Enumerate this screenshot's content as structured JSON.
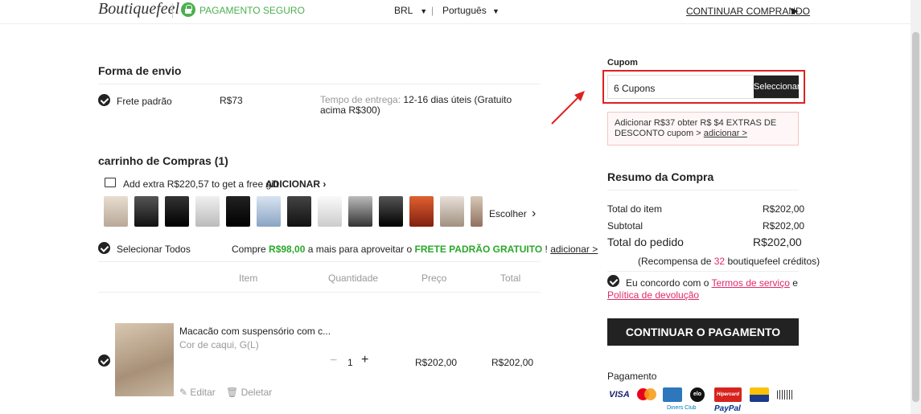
{
  "header": {
    "logo": "Boutiquefeel",
    "secure": "PAGAMENTO SEGURO",
    "currency": "BRL",
    "language": "Português",
    "continue": "CONTINUAR COMPRANDO"
  },
  "shipping": {
    "title": "Forma de envio",
    "method": "Frete padrão",
    "price": "R$73",
    "time_label": "Tempo de entrega:",
    "time_value": "12-16 dias úteis (Gratuito acima R$300)"
  },
  "cart": {
    "title": "carrinho de Compras (1)",
    "gift_text": "Add extra R$220,57 to get a free gift",
    "gift_add": "ADICIONAR",
    "choose": "Escolher",
    "select_all": "Selecionar Todos",
    "free_pre": "Compre",
    "free_amount": "R$98,00",
    "free_mid": "a mais para aproveitar o",
    "free_label": "FRETE PADRÃO GRATUITO",
    "free_post": "!",
    "free_add": "adicionar >",
    "cols": [
      "Item",
      "Quantidade",
      "Preço",
      "Total"
    ],
    "item": {
      "name": "Macacão com suspensório com c...",
      "variant": "Cor de caqui, G(L)",
      "qty": "1",
      "price": "R$202,00",
      "total": "R$202,00",
      "edit": "Editar",
      "delete": "Deletar"
    }
  },
  "coupon": {
    "label": "Cupom",
    "value": "6 Cupons",
    "button": "Seleccionar",
    "promo_text": "Adicionar R$37 obter R$ $4 EXTRAS DE DESCONTO cupom >",
    "promo_link": "adicionar >"
  },
  "summary": {
    "title": "Resumo da Compra",
    "item_total_label": "Total do item",
    "item_total": "R$202,00",
    "subtotal_label": "Subtotal",
    "subtotal": "R$202,00",
    "order_total_label": "Total do pedido",
    "order_total": "R$202,00",
    "reward_pre": "(Recompensa de",
    "reward_num": "32",
    "reward_post": "boutiquefeel créditos)",
    "agree_pre": "Eu concordo com o",
    "terms": "Termos de serviço",
    "agree_and": "e",
    "returns": "Política de devolução",
    "button": "CONTINUAR O PAGAMENTO"
  },
  "payment": {
    "title": "Pagamento",
    "visa": "VISA",
    "hipercard": "Hipercard",
    "elo": "elo",
    "diners": "Diners Club",
    "paypal": "PayPal"
  },
  "colors": {
    "accent_green": "#4caf50",
    "red": "#e02020",
    "pink_link": "#e0286a"
  }
}
